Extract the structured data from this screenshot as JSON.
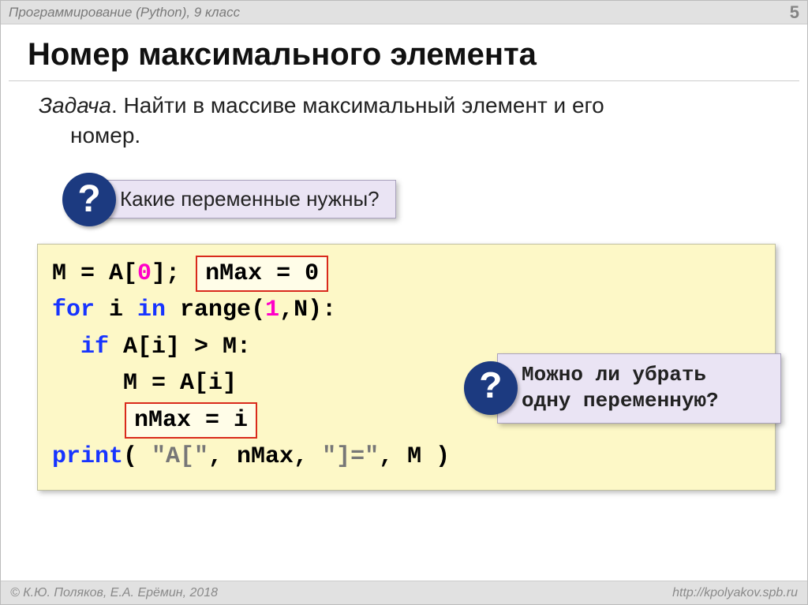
{
  "header": {
    "subject": "Программирование (Python), 9 класс",
    "page": "5"
  },
  "title": "Номер максимального элемента",
  "task": {
    "label": "Задача",
    "text_part1": ". Найти в массиве максимальный элемент и его",
    "text_part2": "номер."
  },
  "question1": "Какие переменные нужны?",
  "code": {
    "l1_a": "M = A[",
    "l1_zero": "0",
    "l1_b": "]; ",
    "l1_hl": "nMax = 0",
    "l2_for": "for",
    "l2_mid": " i ",
    "l2_in": "in",
    "l2_range": " range(",
    "l2_one": "1",
    "l2_end": ",N):",
    "l3_if": "if",
    "l3_rest": " A[i] > M:",
    "l4": "M = A[i]",
    "l5_hl": "nMax = i",
    "l6_print": "print",
    "l6_a": "( ",
    "l6_s1": "\"A[\"",
    "l6_b": ", nMax, ",
    "l6_s2": "\"]=\"",
    "l6_c": ", M )"
  },
  "question2": "Можно ли убрать одну переменную?",
  "footer": {
    "left": "© К.Ю. Поляков, Е.А. Ерёмин, 2018",
    "right": "http://kpolyakov.spb.ru"
  }
}
